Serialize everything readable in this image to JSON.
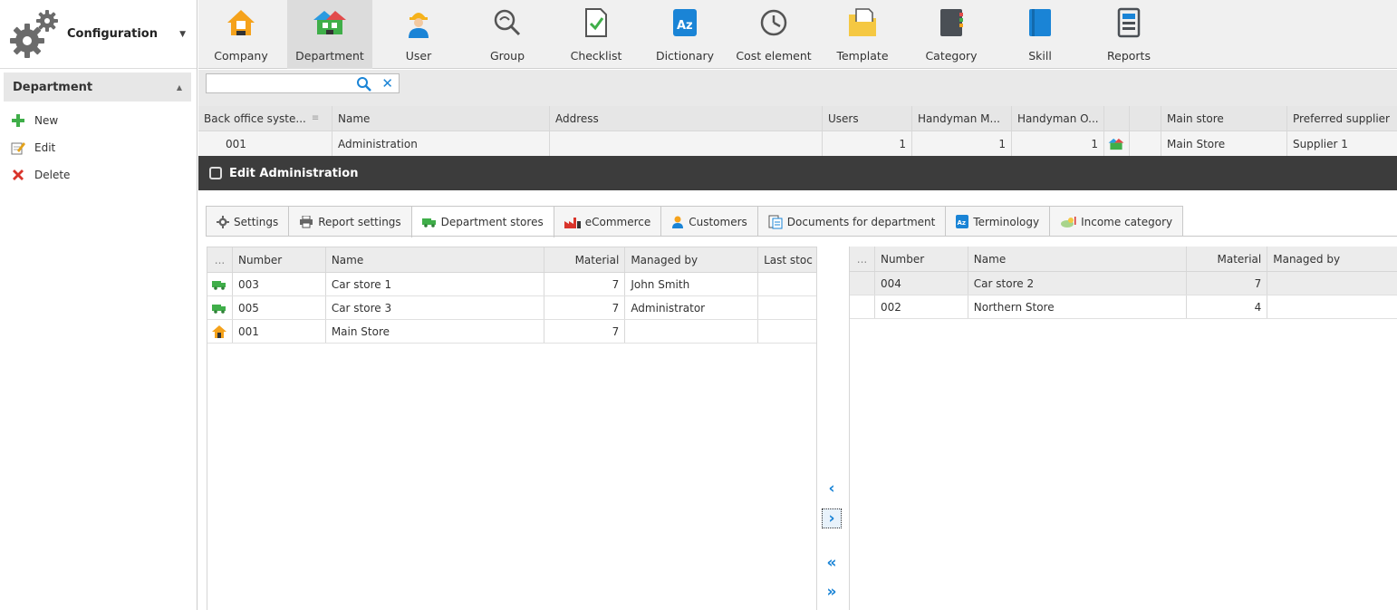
{
  "config": {
    "label": "Configuration"
  },
  "sidebar": {
    "section_title": "Department",
    "actions": [
      {
        "label": "New",
        "icon": "plus-icon"
      },
      {
        "label": "Edit",
        "icon": "edit-icon"
      },
      {
        "label": "Delete",
        "icon": "delete-icon"
      }
    ]
  },
  "toolbar": {
    "items": [
      {
        "label": "Company",
        "icon": "company-icon"
      },
      {
        "label": "Department",
        "icon": "department-icon",
        "active": true
      },
      {
        "label": "User",
        "icon": "user-icon"
      },
      {
        "label": "Group",
        "icon": "group-icon"
      },
      {
        "label": "Checklist",
        "icon": "checklist-icon"
      },
      {
        "label": "Dictionary",
        "icon": "dictionary-icon"
      },
      {
        "label": "Cost element",
        "icon": "clock-icon"
      },
      {
        "label": "Template",
        "icon": "template-icon"
      },
      {
        "label": "Category",
        "icon": "category-icon"
      },
      {
        "label": "Skill",
        "icon": "skill-icon"
      },
      {
        "label": "Reports",
        "icon": "reports-icon"
      }
    ]
  },
  "search": {
    "value": ""
  },
  "main_grid": {
    "columns": [
      "Back office syste...",
      "Name",
      "Address",
      "Users",
      "Handyman M...",
      "Handyman O...",
      "",
      "",
      "Main store",
      "Preferred supplier"
    ],
    "rows": [
      {
        "back_office": "001",
        "name": "Administration",
        "address": "",
        "users": "1",
        "handyman_m": "1",
        "handyman_o": "1",
        "main_store": "Main Store",
        "preferred_supplier": "Supplier 1"
      }
    ]
  },
  "edit": {
    "title": "Edit Administration"
  },
  "tabs": [
    {
      "label": "Settings",
      "icon": "gear-icon"
    },
    {
      "label": "Report settings",
      "icon": "printer-icon"
    },
    {
      "label": "Department stores",
      "icon": "truck-icon",
      "active": true
    },
    {
      "label": "eCommerce",
      "icon": "factory-icon"
    },
    {
      "label": "Customers",
      "icon": "person-icon"
    },
    {
      "label": "Documents for department",
      "icon": "documents-icon"
    },
    {
      "label": "Terminology",
      "icon": "dictionary-icon"
    },
    {
      "label": "Income category",
      "icon": "income-icon"
    }
  ],
  "left_grid": {
    "columns": [
      "...",
      "Number",
      "Name",
      "Material",
      "Managed by",
      "Last stoc"
    ],
    "rows": [
      {
        "type": "truck",
        "number": "003",
        "name": "Car store 1",
        "material": "7",
        "managed_by": "John Smith"
      },
      {
        "type": "truck",
        "number": "005",
        "name": "Car store 3",
        "material": "7",
        "managed_by": "Administrator"
      },
      {
        "type": "house",
        "number": "001",
        "name": "Main Store",
        "material": "7",
        "managed_by": ""
      }
    ]
  },
  "right_grid": {
    "columns": [
      "...",
      "Number",
      "Name",
      "Material",
      "Managed by"
    ],
    "rows": [
      {
        "number": "004",
        "name": "Car store 2",
        "material": "7",
        "managed_by": ""
      },
      {
        "number": "002",
        "name": "Northern Store",
        "material": "4",
        "managed_by": ""
      }
    ]
  },
  "arrows": {
    "move_left": "‹",
    "move_right": "›",
    "move_all_left": "«",
    "move_all_right": "»"
  },
  "colors": {
    "accent": "#1a84d6",
    "dark_header": "#3c3c3c",
    "green": "#3fae49",
    "red": "#d9342b"
  }
}
